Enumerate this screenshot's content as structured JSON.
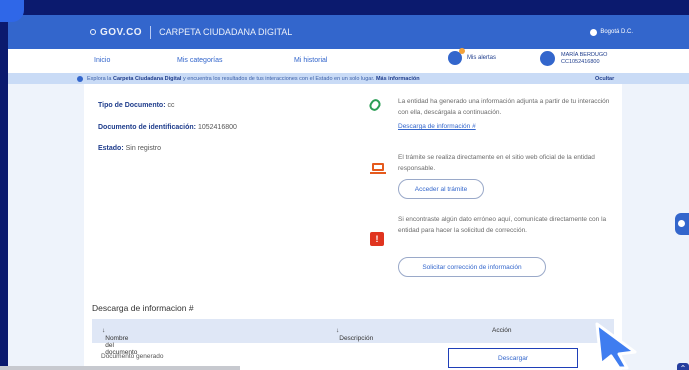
{
  "header": {
    "brand": "GOV.CO",
    "title": "CARPETA CIUDADANA DIGITAL",
    "location": "Bogotá D.C."
  },
  "nav": {
    "items": [
      "Inicio",
      "Mis categorías",
      "Mi historial"
    ],
    "alerts_label": "Mis alertas",
    "user_name": "MARÍA BERDUGO",
    "user_id": "CC1052416800"
  },
  "infobar": {
    "prefix": "Explora la",
    "bold": "Carpeta Ciudadana Digital",
    "rest": "y encuentra los resultados de tus interacciones con el Estado en un solo lugar.",
    "more": "Más información",
    "hide": "Ocultar"
  },
  "details": {
    "doc_type_label": "Tipo de Documento:",
    "doc_type_value": "cc",
    "doc_id_label": "Documento de identificación:",
    "doc_id_value": "1052416800",
    "status_label": "Estado:",
    "status_value": "Sin registro"
  },
  "right": {
    "attach_text": "La entidad ha generado una información adjunta a partir de tu interacción con ella, descárgala a continuación.",
    "attach_link": "Descarga de información #",
    "online_text": "El trámite se realiza directamente en el sitio web oficial de la entidad responsable.",
    "online_button": "Acceder al trámite",
    "error_text": "Si encontraste algún dato erróneo aquí, comunícate directamente con la entidad para hacer la solicitud de corrección.",
    "error_button": "Solicitar corrección de información"
  },
  "downloads": {
    "section_title": "Descarga de informacion #",
    "columns": [
      "Nombre del documento",
      "Descripción",
      "Acción"
    ],
    "rows": [
      {
        "name": "Documento generado",
        "action": "Descargar"
      }
    ]
  }
}
